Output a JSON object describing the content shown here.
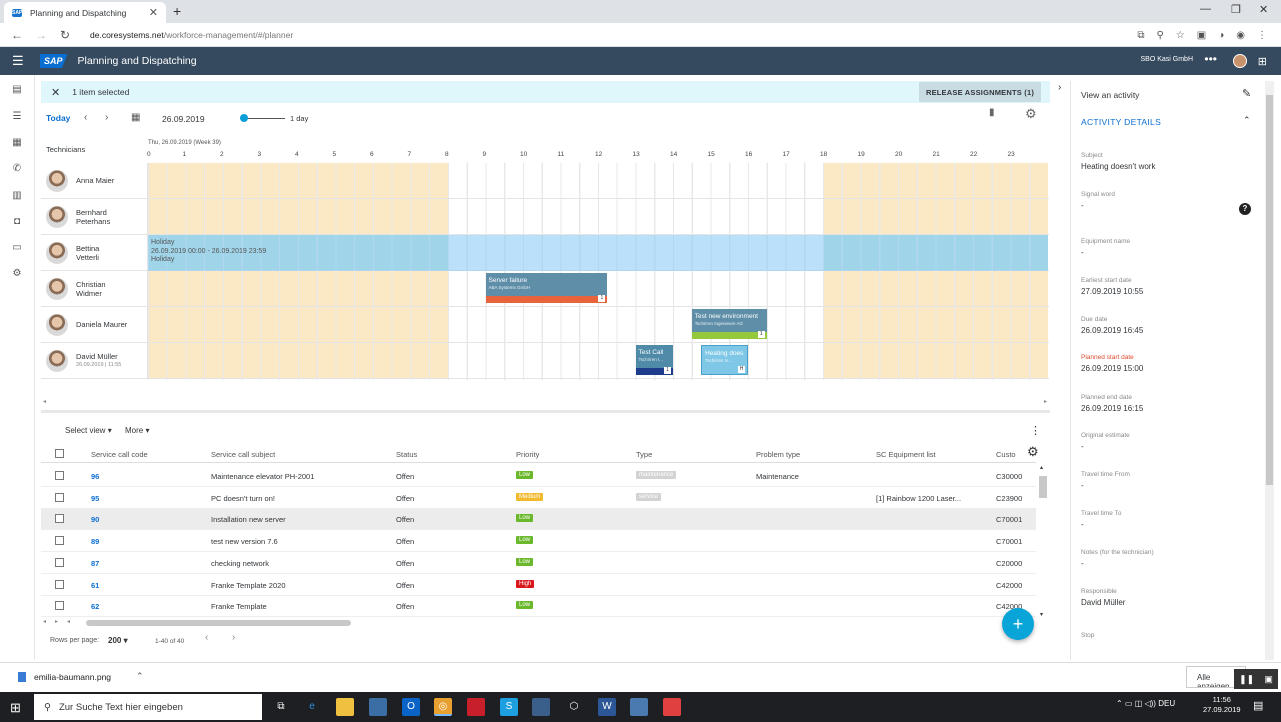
{
  "browser": {
    "tab_title": "Planning and Dispatching",
    "url_host": "de.coresystems.net",
    "url_path": "/workforce-management/#/planner"
  },
  "shell": {
    "brand": "SAP",
    "title": "Planning and Dispatching",
    "company": "SBO Kasi GmbH"
  },
  "selection": {
    "text": "1 item selected",
    "release_label": "RELEASE ASSIGNMENTS (1)"
  },
  "toolbar": {
    "today": "Today",
    "date": "26.09.2019",
    "range": "1 day"
  },
  "gantt": {
    "tech_header": "Technicians",
    "week_header": "Thu, 26.09.2019 (Week 39)",
    "hours": [
      "0",
      "1",
      "2",
      "3",
      "4",
      "5",
      "6",
      "7",
      "8",
      "9",
      "10",
      "11",
      "12",
      "13",
      "14",
      "15",
      "16",
      "17",
      "18",
      "19",
      "20",
      "21",
      "22",
      "23"
    ],
    "technicians": [
      {
        "name1": "Anna Maier",
        "name2": ""
      },
      {
        "name1": "Bernhard",
        "name2": "Peterhans"
      },
      {
        "name1": "Bettina",
        "name2": "Vetterli"
      },
      {
        "name1": "Christian",
        "name2": "Widmer"
      },
      {
        "name1": "Daniela Maurer",
        "name2": ""
      },
      {
        "name1": "David Müller",
        "name2": "",
        "sub": "26.09.2019 | 11:55"
      }
    ],
    "holiday": {
      "line1": "Holiday",
      "line2": "26.09.2019 00:00 - 26.09.2019 23:59",
      "line3": "Holiday"
    },
    "tasks": [
      {
        "title": "Server failure",
        "sub": "ABA Systems GmbH",
        "badge": "1"
      },
      {
        "title": "Test new environment",
        "sub": "Tschirren Ingenieure AG",
        "badge": "1"
      },
      {
        "title": "Test Call",
        "sub": "Tschirren I...",
        "badge": "1"
      },
      {
        "title": "Heating does",
        "sub": "Tschirren In...",
        "badge": "H"
      }
    ]
  },
  "table": {
    "select_view": "Select view",
    "more": "More",
    "headers": [
      "Service call code",
      "Service call subject",
      "Status",
      "Priority",
      "Type",
      "Problem type",
      "SC Equipment list",
      "Custo"
    ],
    "rows": [
      {
        "code": "96",
        "subject": "Maintenance elevator PH-2001",
        "status": "Offen",
        "priority": "Low",
        "type": "maintenance",
        "problem": "Maintenance",
        "equipment": "",
        "customer": "C30000"
      },
      {
        "code": "95",
        "subject": "PC doesn't turn on!",
        "status": "Offen",
        "priority": "Medium",
        "type": "service",
        "problem": "",
        "equipment": "[1] Rainbow 1200 Laser...",
        "customer": "C23900"
      },
      {
        "code": "90",
        "subject": "Installation new server",
        "status": "Offen",
        "priority": "Low",
        "type": "",
        "problem": "",
        "equipment": "",
        "customer": "C70001"
      },
      {
        "code": "89",
        "subject": "test new version 7.6",
        "status": "Offen",
        "priority": "Low",
        "type": "",
        "problem": "",
        "equipment": "",
        "customer": "C70001"
      },
      {
        "code": "87",
        "subject": "checking network",
        "status": "Offen",
        "priority": "Low",
        "type": "",
        "problem": "",
        "equipment": "",
        "customer": "C20000"
      },
      {
        "code": "61",
        "subject": "Franke Template 2020",
        "status": "Offen",
        "priority": "High",
        "type": "",
        "problem": "",
        "equipment": "",
        "customer": "C42000"
      },
      {
        "code": "62",
        "subject": "Franke Template",
        "status": "Offen",
        "priority": "Low",
        "type": "",
        "problem": "",
        "equipment": "",
        "customer": "C42000"
      }
    ],
    "rows_per_page_label": "Rows per page:",
    "rows_per_page": "200",
    "range": "1-40 of 40"
  },
  "panel": {
    "title": "View an activity",
    "section": "ACTIVITY DETAILS",
    "fields": [
      {
        "label": "Subject",
        "value": "Heating doesn't work"
      },
      {
        "label": "Signal word",
        "value": "-"
      },
      {
        "label": "Equipment name",
        "value": "-"
      },
      {
        "label": "Earliest start date",
        "value": "27.09.2019   10:55"
      },
      {
        "label": "Due date",
        "value": "26.09.2019   16:45"
      },
      {
        "label": "Planned start date",
        "value": "26.09.2019   15:00"
      },
      {
        "label": "Planned end date",
        "value": "26.09.2019   16:15"
      },
      {
        "label": "Original estimate",
        "value": "-"
      },
      {
        "label": "Travel time From",
        "value": "-"
      },
      {
        "label": "Travel time To",
        "value": "-"
      },
      {
        "label": "Notes (for the technician)",
        "value": "-"
      },
      {
        "label": "Responsible",
        "value": "David Müller"
      },
      {
        "label": "Stop",
        "value": ""
      }
    ]
  },
  "downloads": {
    "file": "emilia-baumann.png",
    "show_all": "Alle anzeigen"
  },
  "taskbar": {
    "search_placeholder": "Zur Suche Text hier eingeben",
    "lang": "DEU",
    "time": "11:56",
    "date": "27.09.2019"
  },
  "colors": {
    "shell": "#354a5f",
    "accent": "#0a6ed1",
    "offhours": "#fbe9c5",
    "holiday": "#8ccdf5",
    "prio_low": "#6bb82c",
    "prio_medium": "#f0b92e",
    "prio_high": "#d9171b"
  }
}
